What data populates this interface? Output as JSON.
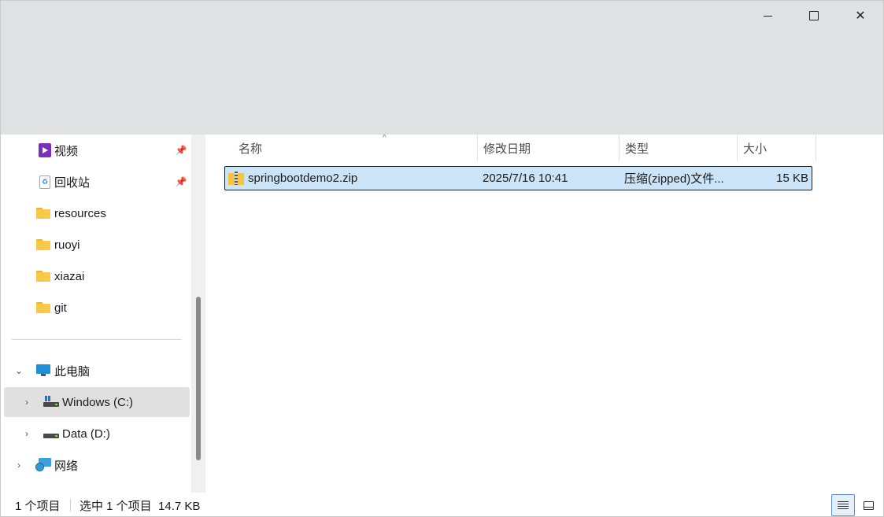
{
  "window": {
    "controls": [
      "minimize",
      "maximize",
      "close"
    ]
  },
  "sidebar": {
    "quick_access": [
      {
        "label": "视频",
        "icon": "video-icon",
        "pinned": true
      },
      {
        "label": "回收站",
        "icon": "recycle-bin-icon",
        "pinned": true
      },
      {
        "label": "resources",
        "icon": "folder-icon",
        "pinned": false
      },
      {
        "label": "ruoyi",
        "icon": "folder-icon",
        "pinned": false
      },
      {
        "label": "xiazai",
        "icon": "folder-icon",
        "pinned": false
      },
      {
        "label": "git",
        "icon": "folder-icon",
        "pinned": false
      }
    ],
    "this_pc": {
      "label": "此电脑",
      "icon": "computer-icon",
      "expanded": true
    },
    "drives": [
      {
        "label": "Windows (C:)",
        "icon": "windows-drive-icon",
        "selected": true
      },
      {
        "label": "Data (D:)",
        "icon": "drive-icon",
        "selected": false
      }
    ],
    "network": {
      "label": "网络",
      "icon": "network-icon"
    }
  },
  "columns": {
    "name": "名称",
    "modified": "修改日期",
    "type": "类型",
    "size": "大小",
    "sort_indicator": "^"
  },
  "files": [
    {
      "name": "springbootdemo2.zip",
      "modified": "2025/7/16 10:41",
      "type": "压缩(zipped)文件...",
      "size": "15 KB",
      "selected": true
    }
  ],
  "status": {
    "count": "1 个项目",
    "selection": "选中 1 个项目  14.7 KB"
  },
  "colors": {
    "selection_bg": "#cce4f7",
    "sidebar_selected_bg": "#e0e0e0",
    "topbar_bg": "#dfe1e3",
    "folder": "#f7c948"
  }
}
